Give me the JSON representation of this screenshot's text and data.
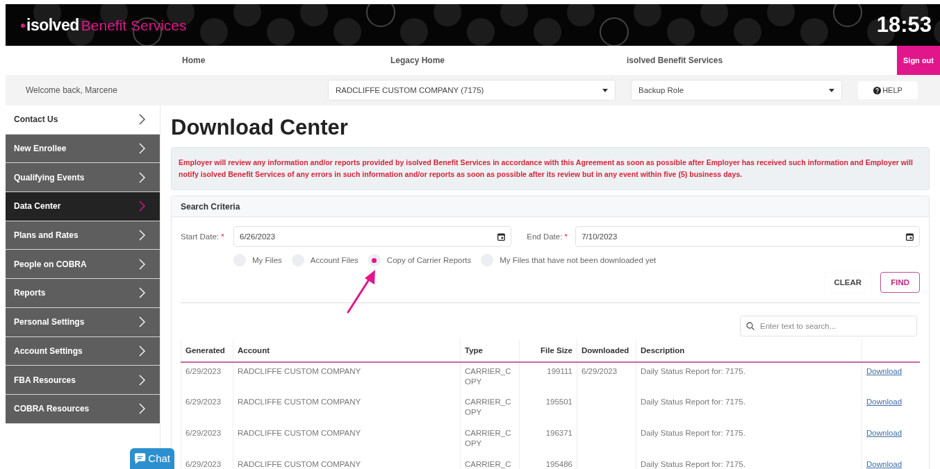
{
  "header": {
    "logo_brand": "isolved",
    "logo_product": "Benefit Services",
    "clock": "18:53"
  },
  "nav": {
    "items": [
      {
        "label": "Home"
      },
      {
        "label": "Legacy Home"
      },
      {
        "label": "isolved Benefit Services"
      }
    ],
    "sign_out": "Sign out"
  },
  "context_bar": {
    "welcome": "Welcome back, Marcene",
    "company_select": "RADCLIFFE CUSTOM COMPANY (7175)",
    "role_select": "Backup Role",
    "help": "HELP"
  },
  "sidebar": {
    "items": [
      {
        "label": "Contact Us",
        "kind": "plain",
        "selected": false
      },
      {
        "label": "New Enrollee",
        "kind": "menu",
        "selected": false
      },
      {
        "label": "Qualifying Events",
        "kind": "menu",
        "selected": false
      },
      {
        "label": "Data Center",
        "kind": "menu",
        "selected": true
      },
      {
        "label": "Plans and Rates",
        "kind": "menu",
        "selected": false
      },
      {
        "label": "People on COBRA",
        "kind": "menu",
        "selected": false
      },
      {
        "label": "Reports",
        "kind": "menu",
        "selected": false
      },
      {
        "label": "Personal Settings",
        "kind": "menu",
        "selected": false
      },
      {
        "label": "Account Settings",
        "kind": "menu",
        "selected": false
      },
      {
        "label": "FBA Resources",
        "kind": "menu",
        "selected": false
      },
      {
        "label": "COBRA Resources",
        "kind": "menu",
        "selected": false
      }
    ]
  },
  "page_title": "Download Center",
  "notice": "Employer will review any information and/or reports provided by isolved Benefit Services in accordance with this Agreement as soon as possible after Employer has received such information and Employer will notify isolved Benefit Services of any errors in such information and/or reports as soon as possible after its review but in any event within five (5) business days.",
  "search_criteria": {
    "title": "Search Criteria",
    "start_date": {
      "label": "Start Date:",
      "required": "*",
      "value": "6/26/2023"
    },
    "end_date": {
      "label": "End Date:",
      "required": "*",
      "value": "7/10/2023"
    },
    "file_options": [
      {
        "label": "My Files",
        "selected": false
      },
      {
        "label": "Account Files",
        "selected": false
      },
      {
        "label": "Copy of Carrier Reports",
        "selected": true
      },
      {
        "label": "My Files that have not been downloaded yet",
        "selected": false
      }
    ],
    "buttons": [
      "CLEAR",
      "FIND"
    ]
  },
  "table_search": {
    "placeholder": "Enter text to search..."
  },
  "table": {
    "columns": [
      "Generated",
      "Account",
      "Type",
      "File Size",
      "Downloaded",
      "Description"
    ],
    "rows": [
      {
        "generated": "6/29/2023",
        "account": "RADCLIFFE CUSTOM COMPANY",
        "type": "CARRIER_COPY",
        "file_size": "199111",
        "downloaded": "6/29/2023",
        "description": "Daily Status Report for: 7175.",
        "action": "Download"
      },
      {
        "generated": "6/29/2023",
        "account": "RADCLIFFE CUSTOM COMPANY",
        "type": "CARRIER_COPY",
        "file_size": "195501",
        "description": "Daily Status Report for: 7175.",
        "action": "Download"
      },
      {
        "generated": "6/29/2023",
        "account": "RADCLIFFE CUSTOM COMPANY",
        "type": "CARRIER_COPY",
        "file_size": "196371",
        "description": "Daily Status Report for: 7175.",
        "action": "Download"
      },
      {
        "generated": "6/29/2023",
        "account": "RADCLIFFE CUSTOM COMPANY",
        "type": "CARRIER_C",
        "file_size": "195486",
        "description": "Daily Status Report for: 7175.",
        "action": "Download"
      }
    ]
  },
  "chat": {
    "label": "Chat"
  }
}
